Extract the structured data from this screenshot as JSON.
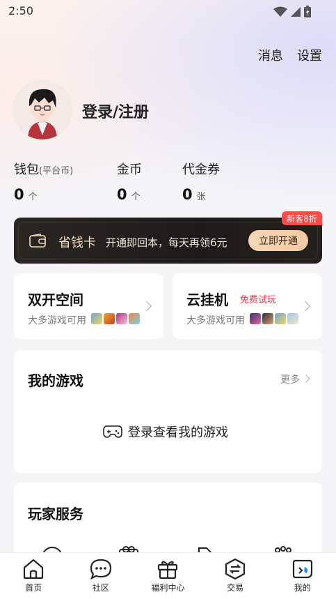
{
  "status_bar": {
    "time": "2:50"
  },
  "header": {
    "messages_label": "消息",
    "settings_label": "设置"
  },
  "profile": {
    "login_label": "登录/注册"
  },
  "wallet": [
    {
      "label": "钱包",
      "sub": "(平台币)",
      "value": "0",
      "unit": "个"
    },
    {
      "label": "金币",
      "sub": "",
      "value": "0",
      "unit": "个"
    },
    {
      "label": "代金券",
      "sub": "",
      "value": "0",
      "unit": "张"
    }
  ],
  "save_card": {
    "badge": "新客8折",
    "title": "省钱卡",
    "desc": "开通即回本，每天再领6元",
    "button": "立即开通"
  },
  "dual_space": {
    "title": "双开空间",
    "sub": "大多游戏可用"
  },
  "cloud_hang": {
    "title": "云挂机",
    "tag": "免费试玩",
    "sub": "大多游戏可用"
  },
  "my_games": {
    "title": "我的游戏",
    "more": "更多",
    "login_prompt": "登录查看我的游戏"
  },
  "player_services": {
    "title": "玩家服务"
  },
  "tabs": [
    {
      "label": "首页",
      "icon": "home-icon"
    },
    {
      "label": "社区",
      "icon": "chat-icon"
    },
    {
      "label": "福利中心",
      "icon": "gift-icon"
    },
    {
      "label": "交易",
      "icon": "exchange-icon"
    },
    {
      "label": "我的",
      "icon": "profile-icon"
    }
  ],
  "colors": {
    "accent": "#e8334a",
    "badge": "#ff4a4a",
    "gold": "#f3dfc3",
    "active_tab": "#1a8cff"
  }
}
